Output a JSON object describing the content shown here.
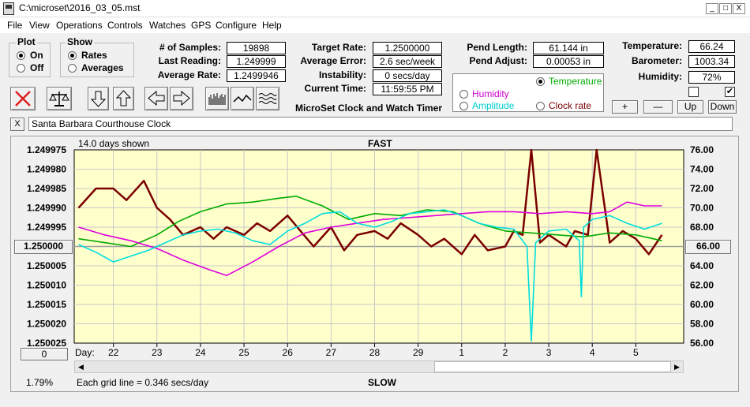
{
  "window": {
    "title": "C:\\microset\\2016_03_05.mst",
    "min": "_",
    "max": "□",
    "close": "X"
  },
  "menu": [
    "File",
    "View",
    "Operations",
    "Controls",
    "Watches",
    "GPS",
    "Configure",
    "Help"
  ],
  "plot_group": {
    "title": "Plot",
    "on": "On",
    "off": "Off",
    "selected": "On"
  },
  "show_group": {
    "title": "Show",
    "rates": "Rates",
    "averages": "Averages",
    "selected": "Rates"
  },
  "stats_left": [
    {
      "label": "# of Samples:",
      "value": "19898"
    },
    {
      "label": "Last Reading:",
      "value": "1.249999"
    },
    {
      "label": "Average Rate:",
      "value": "1.2499946"
    }
  ],
  "stats_mid": [
    {
      "label": "Target Rate:",
      "value": "1.2500000"
    },
    {
      "label": "Average Error:",
      "value": "2.6 sec/week"
    },
    {
      "label": "Instability:",
      "value": "0 secs/day"
    },
    {
      "label": "Current Time:",
      "value": "11:59:55 PM"
    }
  ],
  "app_caption": "MicroSet Clock and Watch Timer",
  "pend": [
    {
      "label": "Pend Length:",
      "value": "61.144 in"
    },
    {
      "label": "Pend Adjust:",
      "value": "0.00053 in"
    }
  ],
  "sensor_select": {
    "temperature": "Temperature",
    "humidity": "Humidity",
    "amplitude": "Amplitude",
    "clock_rate": "Clock rate",
    "selected": "Temperature"
  },
  "env": [
    {
      "label": "Temperature:",
      "value": "66.24"
    },
    {
      "label": "Barometer:",
      "value": "1003.34"
    },
    {
      "label": "Humidity:",
      "value": "72%"
    }
  ],
  "checkboxes": {
    "first": false,
    "second": true
  },
  "scale_buttons": {
    "plus": "+",
    "minus": "—",
    "up": "Up",
    "down": "Down"
  },
  "notes": {
    "clear_label": "X",
    "text": "Santa Barbara Courthouse Clock"
  },
  "chart_header": {
    "days_shown": "14.0 days shown",
    "fast": "FAST",
    "slow": "SLOW",
    "grid_note": "Each grid line = 0.346 secs/day",
    "percent": "1.79%",
    "center_left": "1.250000",
    "center_right": "66.00",
    "offset_button": "0",
    "day_label": "Day:"
  },
  "colors": {
    "chart_bg": "#ffffcc",
    "rate": "#7a0000",
    "temperature": "#00aa00",
    "humidity": "#dd00dd",
    "amplitude": "#00dddd",
    "center_line": "#a0a0a0",
    "error": "#dd2222"
  },
  "chart_data": {
    "type": "line",
    "x_unit": "day",
    "x_ticks": [
      "22",
      "23",
      "24",
      "25",
      "26",
      "27",
      "28",
      "29",
      "1",
      "2",
      "3",
      "4",
      "5"
    ],
    "y_left": {
      "ticks": [
        "1.249975",
        "1.249980",
        "1.249985",
        "1.249990",
        "1.249995",
        "1.250000",
        "1.250005",
        "1.250010",
        "1.250015",
        "1.250020",
        "1.250025"
      ],
      "range": [
        1.249975,
        1.250025
      ],
      "inverted": true
    },
    "y_right": {
      "ticks": [
        "76.00",
        "74.00",
        "72.00",
        "70.00",
        "68.00",
        "66.00",
        "64.00",
        "62.00",
        "60.00",
        "58.00",
        "56.00"
      ],
      "range": [
        56,
        76
      ]
    },
    "x_range": [
      21.1,
      35.1
    ],
    "series": [
      {
        "name": "Clock rate",
        "axis": "left",
        "x": [
          21.2,
          21.6,
          22.0,
          22.3,
          22.7,
          23.0,
          23.3,
          23.6,
          24.0,
          24.3,
          24.6,
          25.0,
          25.3,
          25.6,
          26.0,
          26.3,
          26.6,
          27.0,
          27.3,
          27.6,
          28.0,
          28.3,
          28.6,
          29.0,
          29.3,
          29.6,
          30.0,
          30.3,
          30.6,
          31.0,
          31.2,
          31.4,
          31.6,
          31.8,
          32.0,
          32.4,
          32.6,
          32.9,
          33.1,
          33.4,
          33.7,
          34.0,
          34.3,
          34.6
        ],
        "values": [
          1.24999,
          1.249985,
          1.249985,
          1.249988,
          1.249983,
          1.24999,
          1.249993,
          1.249997,
          1.249995,
          1.249998,
          1.249995,
          1.249997,
          1.249994,
          1.249996,
          1.249992,
          1.249996,
          1.25,
          1.249995,
          1.250001,
          1.249997,
          1.249996,
          1.249998,
          1.249994,
          1.249997,
          1.25,
          1.249998,
          1.250002,
          1.249997,
          1.250001,
          1.25,
          1.249996,
          1.249997,
          1.249975,
          1.249999,
          1.249997,
          1.25,
          1.249996,
          1.249997,
          1.249975,
          1.249999,
          1.249996,
          1.249998,
          1.250002,
          1.249997
        ]
      },
      {
        "name": "Temperature",
        "axis": "right",
        "x": [
          21.2,
          21.8,
          22.4,
          23.0,
          23.5,
          24.0,
          24.6,
          25.2,
          25.8,
          26.2,
          26.8,
          27.4,
          28.0,
          28.6,
          29.2,
          29.8,
          30.4,
          31.0,
          31.6,
          32.2,
          32.8,
          33.4,
          34.0,
          34.4,
          34.6
        ],
        "values": [
          66.8,
          66.4,
          66.0,
          67.2,
          68.6,
          69.6,
          70.4,
          70.6,
          71.0,
          71.2,
          70.2,
          68.8,
          69.4,
          69.2,
          69.8,
          69.6,
          68.4,
          67.6,
          67.4,
          67.2,
          67.0,
          67.4,
          67.2,
          66.8,
          66.6
        ]
      },
      {
        "name": "Humidity",
        "axis": "right",
        "x": [
          21.2,
          21.8,
          22.4,
          23.0,
          23.6,
          24.2,
          24.6,
          25.2,
          25.8,
          26.4,
          27.0,
          27.6,
          28.2,
          28.8,
          29.4,
          30.0,
          30.6,
          31.2,
          31.8,
          32.4,
          33.0,
          33.4,
          33.8,
          34.2,
          34.6
        ],
        "values": [
          68.0,
          67.2,
          66.6,
          65.8,
          64.6,
          63.6,
          63.0,
          64.4,
          66.0,
          67.4,
          68.0,
          68.4,
          68.8,
          69.0,
          69.2,
          69.4,
          69.6,
          69.6,
          69.4,
          69.6,
          69.4,
          69.6,
          70.6,
          70.2,
          70.2
        ]
      },
      {
        "name": "Amplitude",
        "axis": "right",
        "x": [
          21.2,
          21.6,
          22.0,
          22.4,
          22.8,
          23.2,
          23.6,
          24.0,
          24.4,
          24.8,
          25.2,
          25.6,
          26.0,
          26.4,
          26.8,
          27.2,
          27.6,
          28.0,
          28.4,
          28.8,
          29.2,
          29.6,
          30.0,
          30.4,
          30.8,
          31.2,
          31.5,
          31.6,
          31.7,
          32.0,
          32.4,
          32.7,
          32.75,
          32.8,
          33.0,
          33.4,
          33.8,
          34.2,
          34.6
        ],
        "values": [
          66.2,
          65.4,
          64.4,
          65.0,
          65.6,
          66.4,
          67.2,
          67.6,
          67.8,
          67.4,
          66.6,
          66.2,
          67.6,
          68.4,
          69.4,
          69.6,
          68.4,
          68.0,
          68.6,
          69.4,
          69.6,
          69.8,
          69.2,
          68.4,
          68.0,
          67.8,
          66.0,
          56.2,
          66.4,
          67.6,
          67.8,
          66.6,
          60.8,
          68.0,
          68.8,
          69.2,
          68.4,
          67.8,
          68.4
        ]
      }
    ]
  }
}
